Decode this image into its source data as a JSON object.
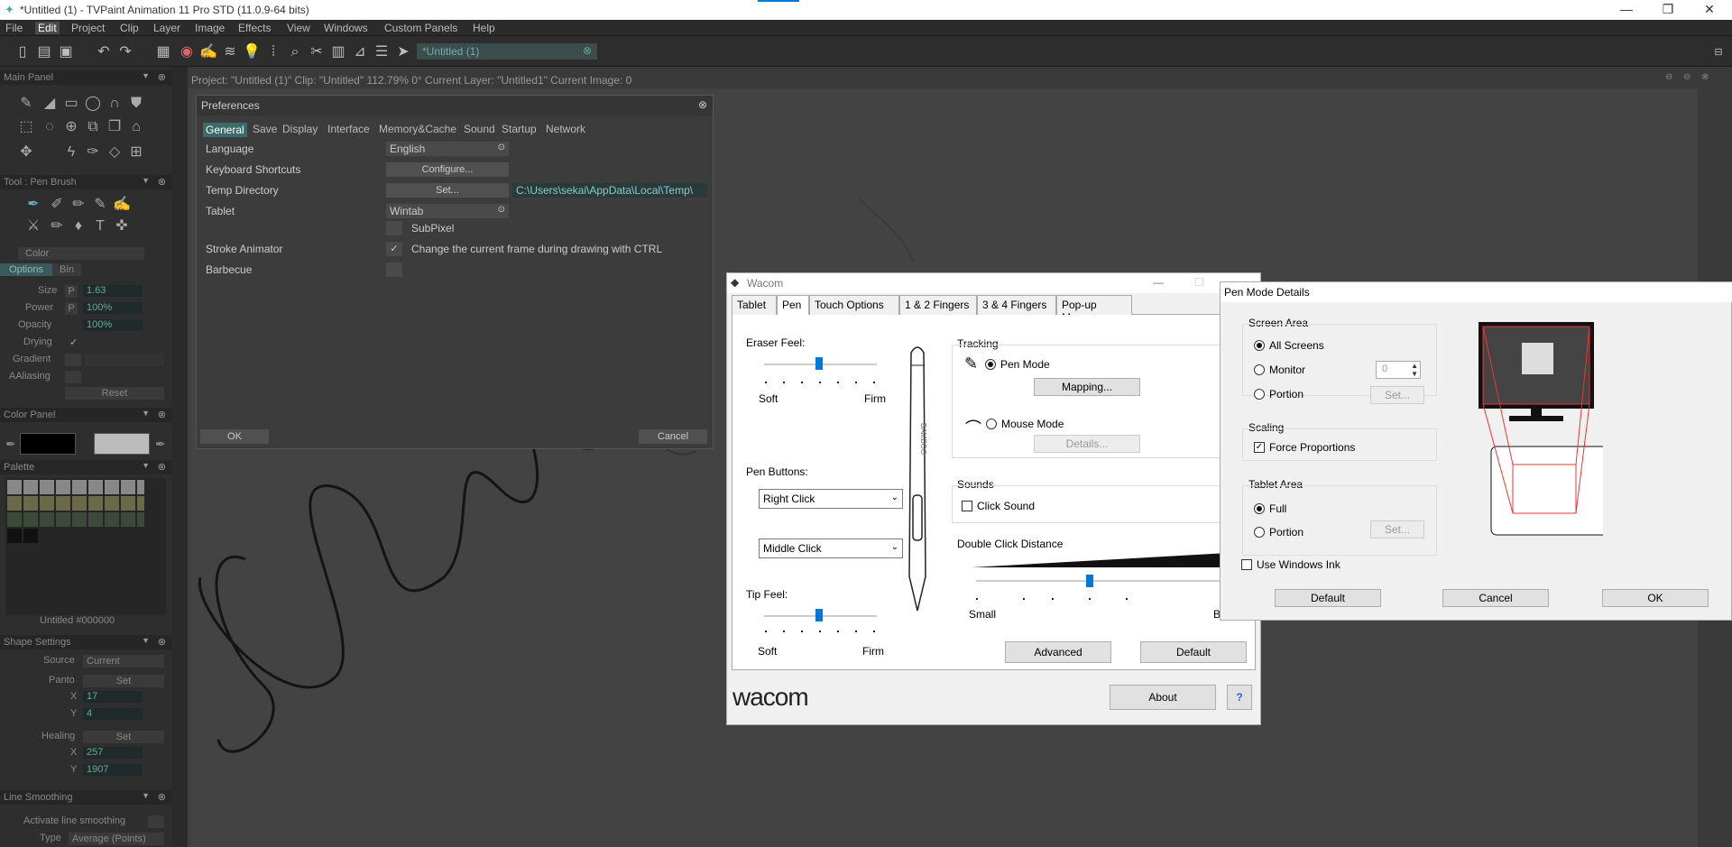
{
  "window": {
    "title": "*Untitled (1) - TVPaint Animation 11 Pro STD (11.0.9-64 bits)",
    "minimize": "—",
    "maximize": "❐",
    "close": "✕"
  },
  "menu": [
    "File",
    "Edit",
    "Project",
    "Clip",
    "Layer",
    "Image",
    "Effects",
    "View",
    "Windows",
    "Custom Panels",
    "Help"
  ],
  "menu_selected": "Edit",
  "doc_tab": "*Untitled (1)",
  "info_bar": "Project: \"Untitled (1)\"  Clip: \"Untitled\"   112.79%   0°  Current Layer: \"Untitled1\"  Current Image: 0",
  "left_panel": {
    "main_panel": "Main Panel",
    "tool_panel": "Tool : Pen Brush",
    "color_label": "Color",
    "options_tab": "Options",
    "bin_tab": "Bin",
    "size_label": "Size",
    "size_value": "1.63",
    "power_label": "Power",
    "power_value": "100%",
    "opacity_label": "Opacity",
    "opacity_value": "100%",
    "drying_label": "Drying",
    "gradient_label": "Gradient",
    "aaliasing_label": "AAliasing",
    "p_label": "P",
    "reset_label": "Reset",
    "color_panel": "Color Panel",
    "palette_panel": "Palette",
    "palette_footer": "Untitled  #000000",
    "shape_settings": "Shape Settings",
    "source_label": "Source",
    "source_value": "Current",
    "panto_label": "Panto",
    "set_label": "Set",
    "x_label": "X",
    "y_label": "Y",
    "panto_x": "17",
    "panto_y": "4",
    "healing_label": "Healing",
    "heal_x": "257",
    "heal_y": "1907",
    "line_smoothing": "Line Smoothing",
    "activate_smoothing": "Activate line smoothing",
    "type_label": "Type",
    "type_value": "Average (Points)"
  },
  "preferences": {
    "title": "Preferences",
    "tabs": [
      "General",
      "Save",
      "Display",
      "Interface",
      "Memory&Cache",
      "Sound",
      "Startup",
      "Network"
    ],
    "language_label": "Language",
    "language_value": "English",
    "shortcuts_label": "Keyboard Shortcuts",
    "configure_btn": "Configure...",
    "temp_label": "Temp Directory",
    "set_btn": "Set...",
    "temp_path": "C:\\Users\\sekai\\AppData\\Local\\Temp\\",
    "tablet_label": "Tablet",
    "tablet_value": "Wintab",
    "subpixel_label": "SubPixel",
    "stroke_label": "Stroke Animator",
    "stroke_desc": "Change the current frame during drawing with CTRL",
    "barbecue_label": "Barbecue",
    "ok_btn": "OK",
    "cancel_btn": "Cancel"
  },
  "wacom": {
    "title": "Wacom",
    "tabs": [
      "Tablet",
      "Pen",
      "Touch Options",
      "1 & 2 Fingers",
      "3 & 4 Fingers",
      "Pop-up Menu"
    ],
    "eraser_feel": "Eraser Feel:",
    "soft": "Soft",
    "firm": "Firm",
    "pen_buttons": "Pen Buttons:",
    "button1": "Right Click",
    "button2": "Middle Click",
    "tip_feel": "Tip Feel:",
    "tracking": "Tracking",
    "pen_mode": "Pen Mode",
    "mapping_btn": "Mapping...",
    "mouse_mode": "Mouse Mode",
    "details_btn": "Details...",
    "sounds": "Sounds",
    "click_sound": "Click Sound",
    "dbl_click": "Double Click Distance",
    "small": "Small",
    "big": "Big",
    "advanced_btn": "Advanced",
    "default_btn": "Default",
    "about_btn": "About",
    "logo": "wacom",
    "pen_brand": "BAMBOO"
  },
  "pen_mode_details": {
    "title": "Pen Mode Details",
    "screen_area": "Screen Area",
    "all_screens": "All Screens",
    "monitor": "Monitor",
    "monitor_value": "0",
    "portion": "Portion",
    "set_btn": "Set...",
    "scaling": "Scaling",
    "force_proportions": "Force Proportions",
    "tablet_area": "Tablet Area",
    "full": "Full",
    "tablet_portion": "Portion",
    "tablet_set_btn": "Set...",
    "windows_ink": "Use Windows Ink",
    "default_btn": "Default",
    "cancel_btn": "Cancel",
    "ok_btn": "OK"
  },
  "colors": {
    "accent": "#0078d7",
    "pref_tab_active": "#3c6b6b"
  }
}
